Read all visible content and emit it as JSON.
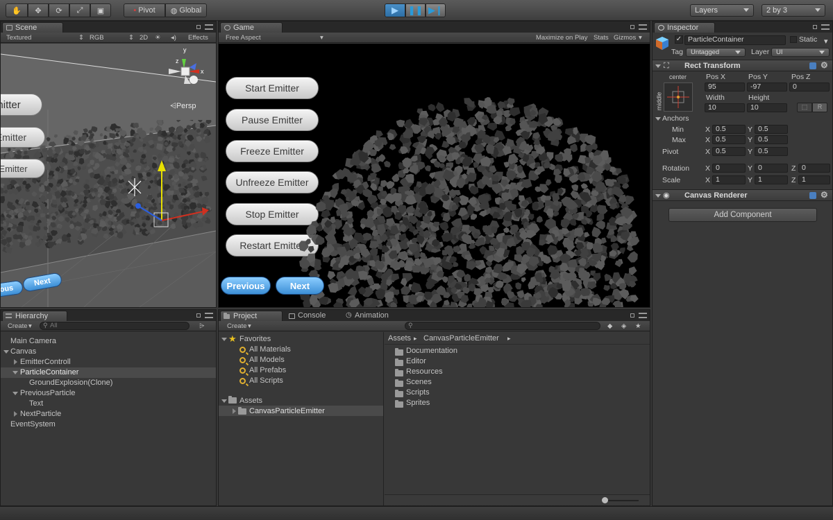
{
  "toolbar": {
    "pivot": "Pivot",
    "global": "Global",
    "layers": "Layers",
    "layout": "2 by 3",
    "play_icon": "play-icon",
    "pause_icon": "pause-icon",
    "step_icon": "step-icon"
  },
  "scene": {
    "tab": "Scene",
    "shading": "Textured",
    "render_mode": "RGB",
    "mode_2d": "2D",
    "effects": "Effects",
    "persp": "Persp",
    "gizmo_y": "y",
    "gizmo_x": "x",
    "gizmo_z": "z",
    "buttons": [
      "mitter",
      "Emitter",
      "Emitter"
    ],
    "prev": "ious",
    "next": "Next"
  },
  "game": {
    "tab": "Game",
    "aspect": "Free Aspect",
    "maximize": "Maximize on Play",
    "stats": "Stats",
    "gizmos": "Gizmos",
    "buttons": [
      "Start Emitter",
      "Pause Emitter",
      "Freeze Emitter",
      "Unfreeze Emitter",
      "Stop Emitter",
      "Restart Emitter"
    ],
    "previous": "Previous",
    "next": "Next"
  },
  "inspector": {
    "tab": "Inspector",
    "object_name": "ParticleContainer",
    "static": "Static",
    "tag_label": "Tag",
    "tag_value": "Untagged",
    "layer_label": "Layer",
    "layer_value": "UI",
    "rect_transform": "Rect Transform",
    "anchor_h": "center",
    "anchor_v": "middle",
    "posx_label": "Pos X",
    "posy_label": "Pos Y",
    "posz_label": "Pos Z",
    "posx": "95",
    "posy": "-97",
    "posz": "0",
    "width_label": "Width",
    "height_label": "Height",
    "width": "10",
    "height": "10",
    "r_button": "R",
    "anchors": "Anchors",
    "min": "Min",
    "max": "Max",
    "pivot": "Pivot",
    "min_x": "0.5",
    "min_y": "0.5",
    "max_x": "0.5",
    "max_y": "0.5",
    "pivot_x": "0.5",
    "pivot_y": "0.5",
    "rotation": "Rotation",
    "rot_x": "0",
    "rot_y": "0",
    "rot_z": "0",
    "scale": "Scale",
    "scale_x": "1",
    "scale_y": "1",
    "scale_z": "1",
    "x": "X",
    "y": "Y",
    "z": "Z",
    "canvas_renderer": "Canvas Renderer",
    "add_component": "Add Component"
  },
  "hierarchy": {
    "tab": "Hierarchy",
    "create": "Create",
    "search_placeholder": "All",
    "items": [
      {
        "label": "Main Camera"
      },
      {
        "label": "Canvas"
      },
      {
        "label": "EmitterControll"
      },
      {
        "label": "ParticleContainer"
      },
      {
        "label": "GroundExplosion(Clone)"
      },
      {
        "label": "PreviousParticle"
      },
      {
        "label": "Text"
      },
      {
        "label": "NextParticle"
      },
      {
        "label": "EventSystem"
      }
    ]
  },
  "project": {
    "tabs": [
      "Project",
      "Console",
      "Animation"
    ],
    "create": "Create",
    "favorites": "Favorites",
    "fav_items": [
      "All Materials",
      "All Models",
      "All Prefabs",
      "All Scripts"
    ],
    "assets": "Assets",
    "asset_child": "CanvasParticleEmitter",
    "breadcrumb_root": "Assets",
    "breadcrumb_child": "CanvasParticleEmitter",
    "folders": [
      "Documentation",
      "Editor",
      "Resources",
      "Scenes",
      "Scripts",
      "Sprites"
    ]
  },
  "colors": {
    "accent": "#3c8fd6",
    "selection": "#4a4a4a",
    "background": "#383838"
  }
}
